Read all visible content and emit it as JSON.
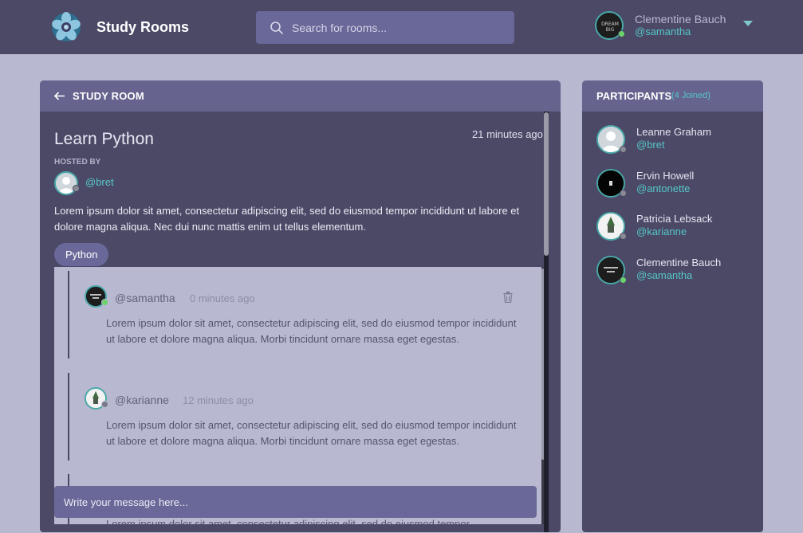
{
  "header": {
    "brand": "Study Rooms",
    "search_placeholder": "Search for rooms...",
    "user": {
      "name": "Clementine Bauch",
      "handle": "@samantha"
    },
    "avatar_text": "DREAM\nBIG"
  },
  "room": {
    "header_label": "STUDY ROOM",
    "title": "Learn Python",
    "time": "21 minutes ago",
    "hosted_label": "HOSTED BY",
    "host_handle": "@bret",
    "description": "Lorem ipsum dolor sit amet, consectetur adipiscing elit, sed do eiusmod tempor incididunt ut labore et dolore magna aliqua. Nec dui nunc mattis enim ut tellus elementum.",
    "topic": "Python",
    "messages": [
      {
        "handle": "@samantha",
        "time": "0 minutes ago",
        "body": "Lorem ipsum dolor sit amet, consectetur adipiscing elit, sed do eiusmod tempor incididunt ut labore et dolore magna aliqua. Morbi tincidunt ornare massa eget egestas.",
        "online": true,
        "deletable": true
      },
      {
        "handle": "@karianne",
        "time": "12 minutes ago",
        "body": "Lorem ipsum dolor sit amet, consectetur adipiscing elit, sed do eiusmod tempor incididunt ut labore et dolore magna aliqua. Morbi tincidunt ornare massa eget egestas.",
        "online": false,
        "deletable": false
      },
      {
        "body": "Lorem ipsum dolor sit amet, consectetur adipiscing elit, sed do eiusmod tempor"
      }
    ],
    "composer_placeholder": "Write your message here..."
  },
  "participants": {
    "title": "PARTICIPANTS",
    "count": "(4 Joined)",
    "list": [
      {
        "name": "Leanne Graham",
        "handle": "@bret",
        "online": false
      },
      {
        "name": "Ervin Howell",
        "handle": "@antonette",
        "online": false
      },
      {
        "name": "Patricia Lebsack",
        "handle": "@karianne",
        "online": false
      },
      {
        "name": "Clementine Bauch",
        "handle": "@samantha",
        "online": true
      }
    ]
  },
  "colors": {
    "accent": "#55c6c6",
    "online": "#6cd36c",
    "offline": "#8a8a96",
    "panel": "#4b4966",
    "panel_header": "#66638f"
  }
}
